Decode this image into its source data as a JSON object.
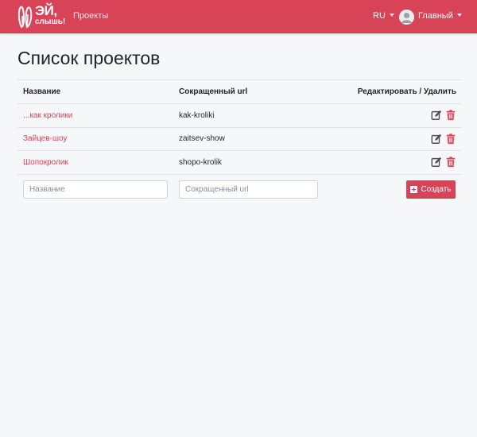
{
  "brand": {
    "main": "ЭЙ,",
    "sub": "слышь!"
  },
  "nav": {
    "projects_link": "Проекты"
  },
  "header_right": {
    "language": "RU",
    "user_name": "Главный"
  },
  "colors": {
    "accent": "#d94357",
    "background": "#f6f7f9"
  },
  "page": {
    "title": "Список проектов"
  },
  "table": {
    "columns": [
      "Название",
      "Сокращенный url",
      "Редактировать / Удалить"
    ],
    "rows": [
      {
        "name": "...как кролики",
        "url": "kak-kroliki"
      },
      {
        "name": "Зайцев-шоу",
        "url": "zaitsev-show"
      },
      {
        "name": "Шопокролик",
        "url": "shopo-krolik"
      }
    ]
  },
  "form": {
    "name_placeholder": "Название",
    "url_placeholder": "Сокращенный url",
    "create_label": "Создать"
  },
  "icons": {
    "edit": "edit-icon",
    "delete": "trash-icon",
    "create": "plus-square-icon"
  }
}
